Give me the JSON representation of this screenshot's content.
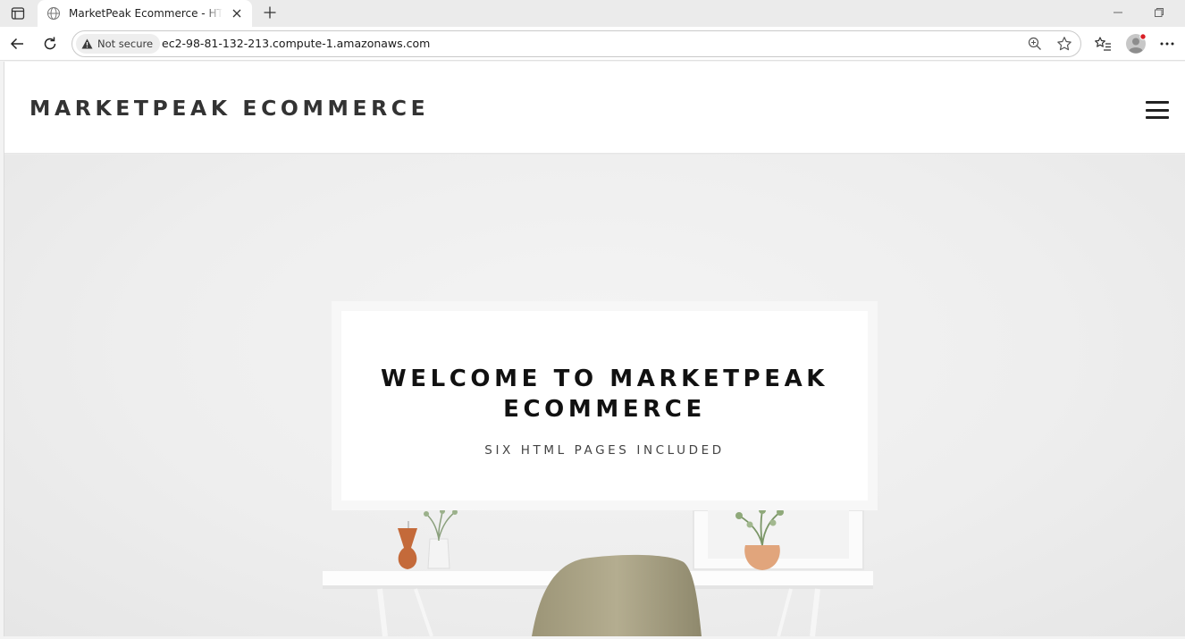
{
  "browser": {
    "tab_title": "MarketPeak Ecommerce - HTML C",
    "security_label": "Not secure",
    "url": "ec2-98-81-132-213.compute-1.amazonaws.com"
  },
  "site": {
    "brand": "MARKETPEAK ECOMMERCE"
  },
  "hero": {
    "title": "WELCOME TO MARKETPEAK ECOMMERCE",
    "subtitle": "SIX HTML PAGES INCLUDED"
  },
  "colors": {
    "page_bg": "#ececec",
    "brand_text": "#333333",
    "hero_title": "#111111",
    "profile_dot": "#d81f26"
  }
}
